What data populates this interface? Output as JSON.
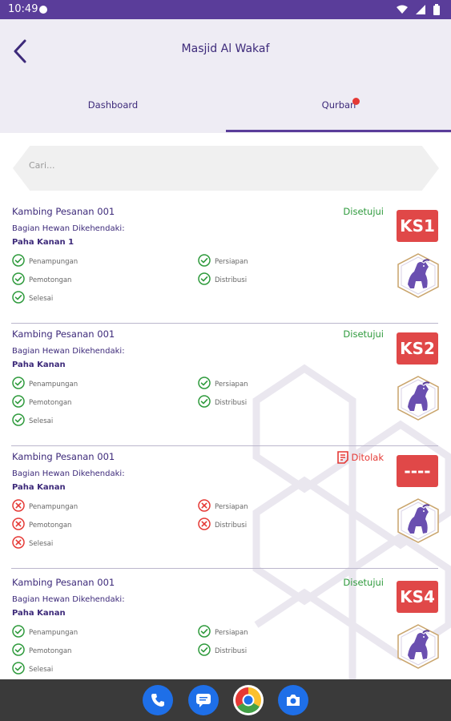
{
  "status_bar": {
    "time": "10:49"
  },
  "header": {
    "title": "Masjid Al Wakaf"
  },
  "tabs": [
    {
      "label": "Dashboard",
      "active": false
    },
    {
      "label": "Qurban",
      "active": true,
      "has_notification": true
    }
  ],
  "search": {
    "placeholder": "Cari..."
  },
  "colors": {
    "primary": "#5a3d9a",
    "approved": "#2e9a3c",
    "rejected": "#e53935",
    "badge": "#e04848"
  },
  "orders": [
    {
      "name": "Kambing Pesanan 001",
      "status": "Disetujui",
      "status_type": "approved",
      "bagian_label": "Bagian Hewan Dikehendaki:",
      "part": "Paha Kanan 1",
      "code": "KS1",
      "steps": [
        "Penampungan",
        "Persiapan",
        "Pemotongan",
        "Distribusi",
        "Selesai"
      ]
    },
    {
      "name": "Kambing Pesanan 001",
      "status": "Disetujui",
      "status_type": "approved",
      "bagian_label": "Bagian Hewan Dikehendaki:",
      "part": "Paha Kanan",
      "code": "KS2",
      "steps": [
        "Penampungan",
        "Persiapan",
        "Pemotongan",
        "Distribusi",
        "Selesai"
      ]
    },
    {
      "name": "Kambing Pesanan 001",
      "status": "Ditolak",
      "status_type": "rejected",
      "bagian_label": "Bagian Hewan Dikehendaki:",
      "part": "Paha Kanan",
      "code": "----",
      "steps": [
        "Penampungan",
        "Persiapan",
        "Pemotongan",
        "Distribusi",
        "Selesai"
      ]
    },
    {
      "name": "Kambing Pesanan 001",
      "status": "Disetujui",
      "status_type": "approved",
      "bagian_label": "Bagian Hewan Dikehendaki:",
      "part": "Paha Kanan",
      "code": "KS4",
      "steps": [
        "Penampungan",
        "Persiapan",
        "Pemotongan",
        "Distribusi",
        "Selesai"
      ]
    }
  ],
  "dock_apps": [
    "phone-icon",
    "messages-icon",
    "chrome-icon",
    "camera-icon"
  ]
}
